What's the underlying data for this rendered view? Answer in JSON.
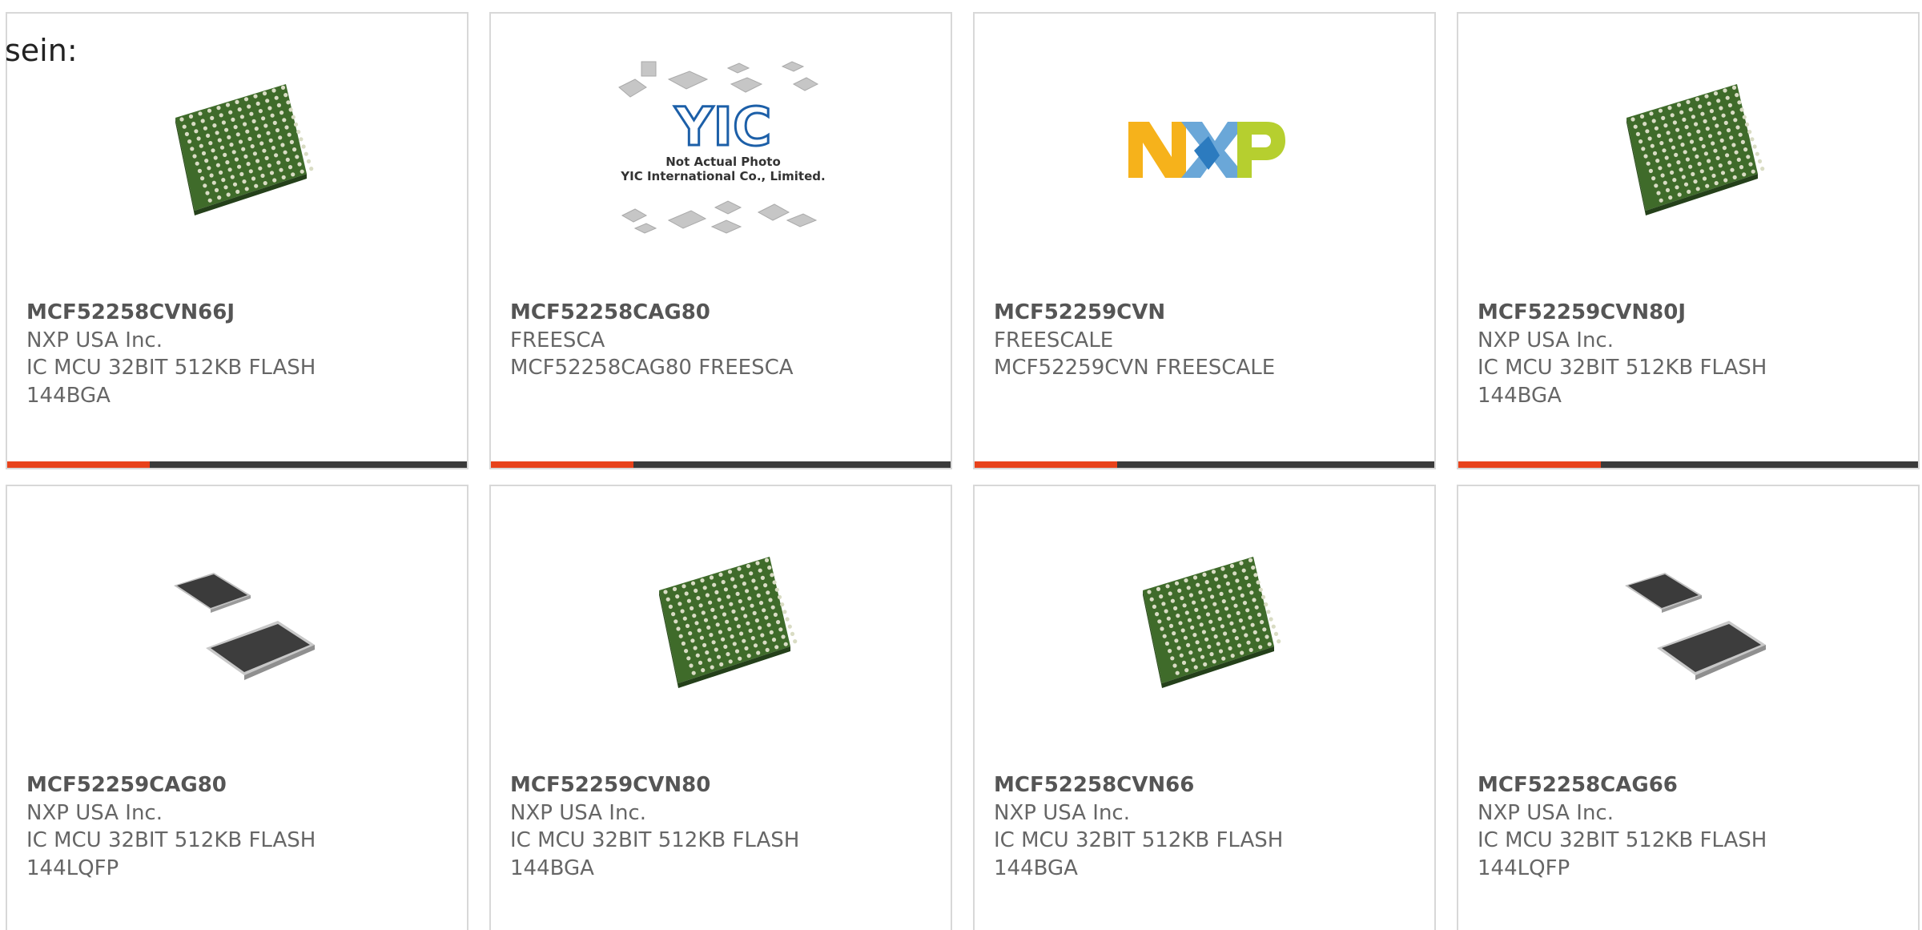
{
  "heading": "sein:",
  "colors": {
    "accent": "#e8421b",
    "bar": "#3a3a3a",
    "border": "#d8d8d8",
    "text": "#666666"
  },
  "products": [
    {
      "part_number": "MCF52258CVN66J",
      "manufacturer": "NXP USA Inc.",
      "description": "IC MCU 32BIT 512KB FLASH\n144BGA",
      "image": "bga-chip",
      "accent_fraction": 0.31
    },
    {
      "part_number": "MCF52258CAG80",
      "manufacturer": "FREESCA",
      "description": "MCF52258CAG80 FREESCA",
      "image": "yic-placeholder",
      "image_text": {
        "logo": "YIC",
        "line1": "Not Actual Photo",
        "line2": "YIC International Co., Limited."
      },
      "accent_fraction": 0.31
    },
    {
      "part_number": "MCF52259CVN",
      "manufacturer": "FREESCALE",
      "description": "MCF52259CVN FREESCALE",
      "image": "nxp-logo",
      "accent_fraction": 0.31
    },
    {
      "part_number": "MCF52259CVN80J",
      "manufacturer": "NXP USA Inc.",
      "description": "IC MCU 32BIT 512KB FLASH\n144BGA",
      "image": "bga-chip",
      "accent_fraction": 0.31
    },
    {
      "part_number": "MCF52259CAG80",
      "manufacturer": "NXP USA Inc.",
      "description": "IC MCU 32BIT 512KB FLASH\n144LQFP",
      "image": "lqfp-chips"
    },
    {
      "part_number": "MCF52259CVN80",
      "manufacturer": "NXP USA Inc.",
      "description": "IC MCU 32BIT 512KB FLASH\n144BGA",
      "image": "bga-chip"
    },
    {
      "part_number": "MCF52258CVN66",
      "manufacturer": "NXP USA Inc.",
      "description": "IC MCU 32BIT 512KB FLASH\n144BGA",
      "image": "bga-chip"
    },
    {
      "part_number": "MCF52258CAG66",
      "manufacturer": "NXP USA Inc.",
      "description": "IC MCU 32BIT 512KB FLASH\n144LQFP",
      "image": "lqfp-chips"
    }
  ]
}
